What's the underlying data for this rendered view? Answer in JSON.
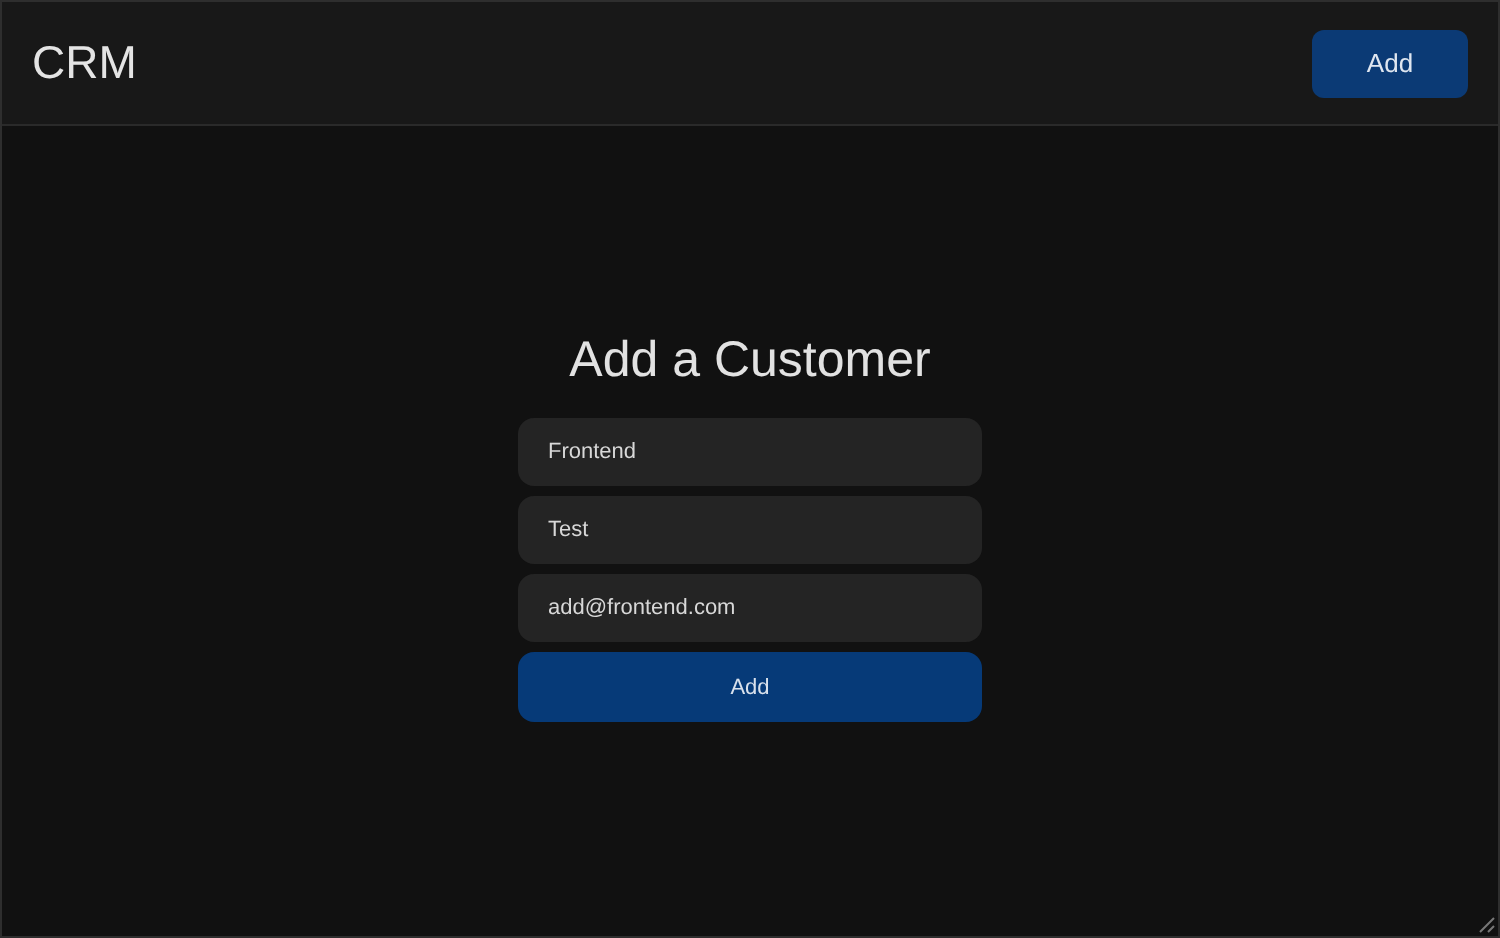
{
  "header": {
    "title": "CRM",
    "button": "Add"
  },
  "form": {
    "title": "Add a Customer",
    "fields": [
      {
        "value": "Frontend"
      },
      {
        "value": "Test"
      },
      {
        "value": "add@frontend.com"
      }
    ],
    "submit": "Add"
  }
}
